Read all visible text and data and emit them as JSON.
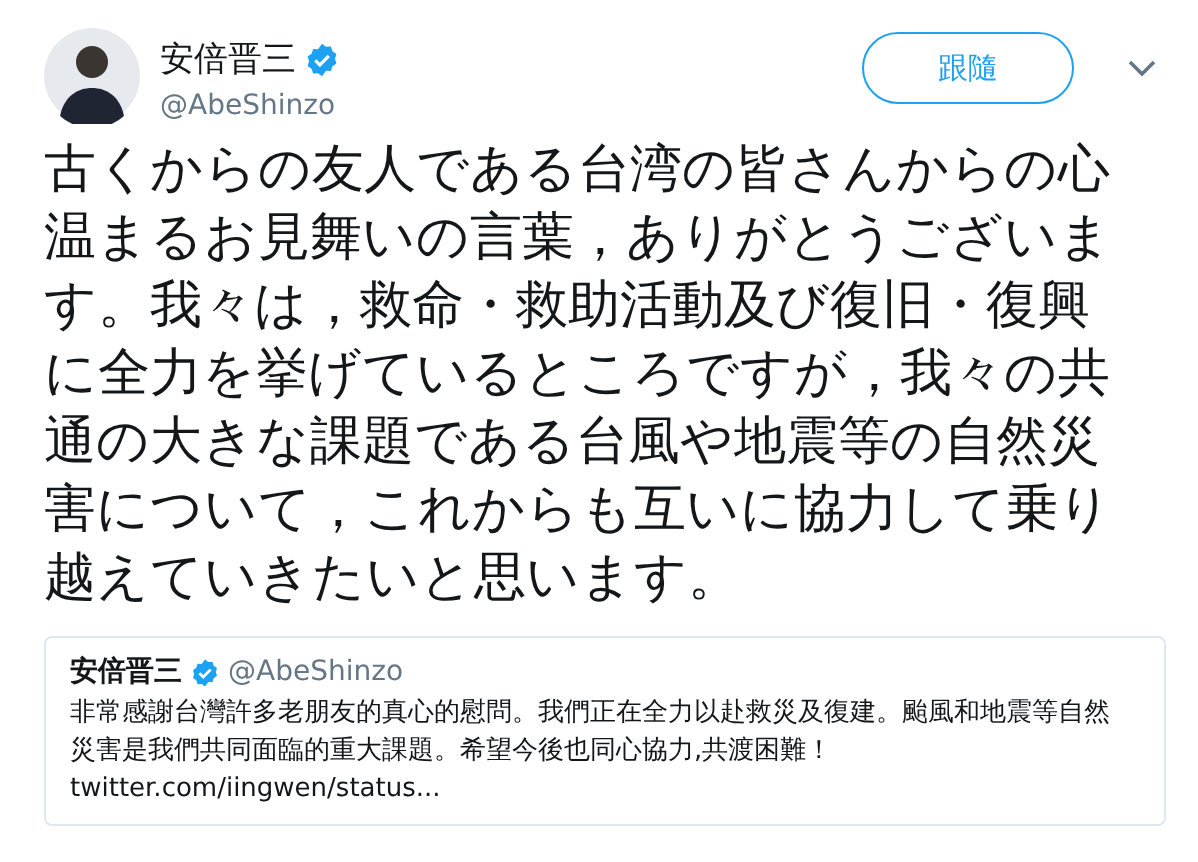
{
  "author": {
    "name": "安倍晋三",
    "verified": true,
    "handle": "@AbeShinzo"
  },
  "follow_button": {
    "label": "跟隨"
  },
  "tweet_text": "古くからの友人である台湾の皆さんからの心温まるお見舞いの言葉，ありがとうございます。我々は，救命・救助活動及び復旧・復興に全力を挙げているところですが，我々の共通の大きな課題である台風や地震等の自然災害について，これからも互いに協力して乗り越えていきたいと思います。",
  "quoted_tweet": {
    "name": "安倍晋三",
    "verified": true,
    "handle": "@AbeShinzo",
    "text": "非常感謝台灣許多老朋友的真心的慰問。我們正在全力以赴救災及復建。颱風和地震等自然災害是我們共同面臨的重大課題。希望今後也同心協力,共渡困難！",
    "link": "twitter.com/iingwen/status..."
  }
}
